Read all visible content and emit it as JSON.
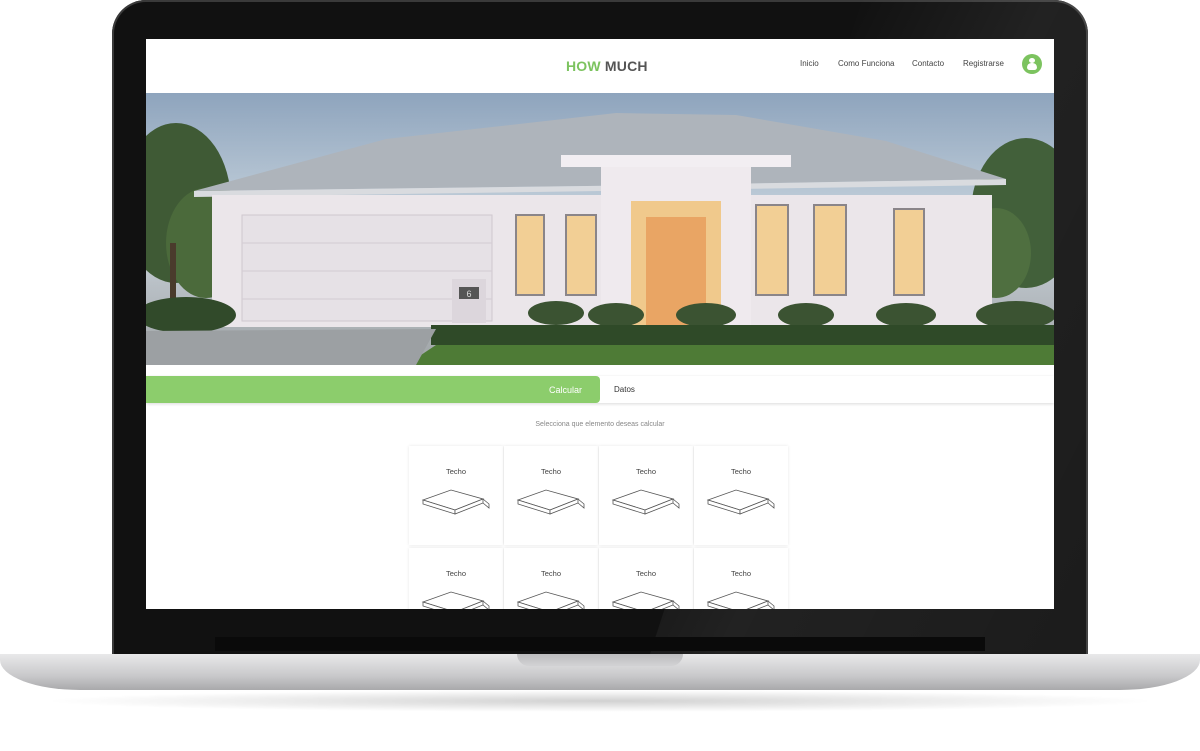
{
  "brand": {
    "first": "HOW",
    "second": "MUCH",
    "accent_color": "#7cc35f"
  },
  "nav": {
    "links": [
      "Inicio",
      "Como Funciona",
      "Contacto",
      "Registrarse"
    ],
    "user_icon": "user-icon"
  },
  "hero": {
    "house_number": "6",
    "slides": 4,
    "active_slide": 1
  },
  "tabs": {
    "items": [
      "Calcular",
      "Datos"
    ],
    "active": "Calcular"
  },
  "prompt": "Selecciona que elemento deseas calcular",
  "elements": [
    {
      "label": "Techo",
      "icon": "roof-slab-icon"
    },
    {
      "label": "Techo",
      "icon": "roof-slab-icon"
    },
    {
      "label": "Techo",
      "icon": "roof-slab-icon"
    },
    {
      "label": "Techo",
      "icon": "roof-slab-icon"
    },
    {
      "label": "Techo",
      "icon": "roof-slab-icon"
    },
    {
      "label": "Techo",
      "icon": "roof-slab-icon"
    },
    {
      "label": "Techo",
      "icon": "roof-slab-icon"
    },
    {
      "label": "Techo",
      "icon": "roof-slab-icon"
    }
  ]
}
